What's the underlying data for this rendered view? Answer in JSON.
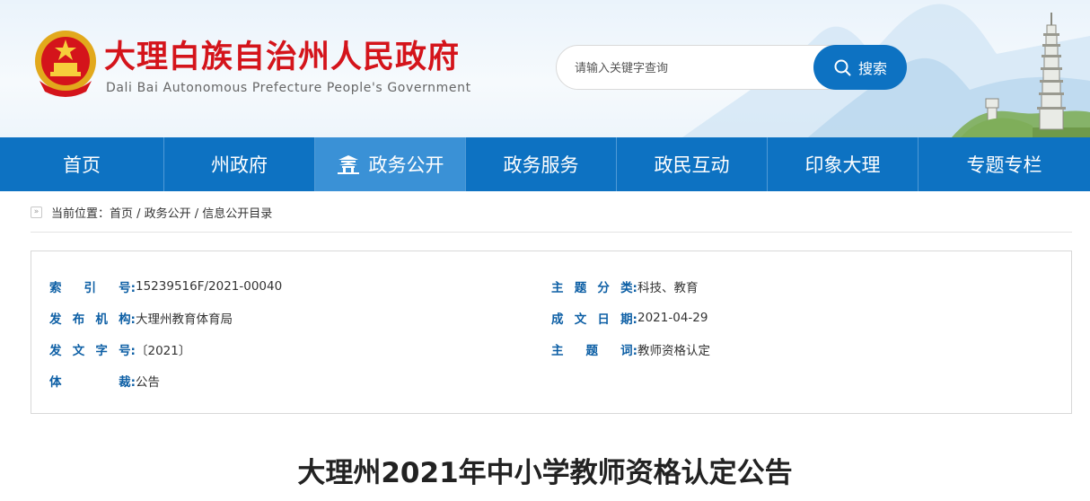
{
  "header": {
    "site_title": "大理白族自治州人民政府",
    "site_subtitle": "Dali Bai Autonomous Prefecture People's Government",
    "search": {
      "placeholder": "请输入关键字查询",
      "button_label": "搜索"
    }
  },
  "nav": {
    "items": [
      {
        "label": "首页"
      },
      {
        "label": "州政府"
      },
      {
        "label": "政务公开"
      },
      {
        "label": "政务服务"
      },
      {
        "label": "政民互动"
      },
      {
        "label": "印象大理"
      },
      {
        "label": "专题专栏"
      }
    ]
  },
  "breadcrumb": {
    "text": "当前位置：首页 / 政务公开 / 信息公开目录"
  },
  "info": {
    "index_label": [
      "索",
      "引",
      "号:"
    ],
    "index_value": "15239516F/2021-00040",
    "publisher_label": [
      "发",
      "布",
      "机",
      "构:"
    ],
    "publisher_value": "大理州教育体育局",
    "doc_no_label": [
      "发",
      "文",
      "字",
      "号:"
    ],
    "doc_no_value": "〔2021〕",
    "genre_label": [
      "体",
      "裁:"
    ],
    "genre_value": "公告",
    "category_label": [
      "主",
      "题",
      "分",
      "类:"
    ],
    "category_value": "科技、教育",
    "date_label": [
      "成",
      "文",
      "日",
      "期:"
    ],
    "date_value": "2021-04-29",
    "keywords_label": [
      "主",
      "题",
      "词:"
    ],
    "keywords_value": "教师资格认定"
  },
  "article": {
    "title": "大理州2021年中小学教师资格认定公告"
  },
  "colors": {
    "brand_blue": "#0d72c2",
    "title_red": "#d4141b",
    "label_blue": "#0d5fa5"
  }
}
